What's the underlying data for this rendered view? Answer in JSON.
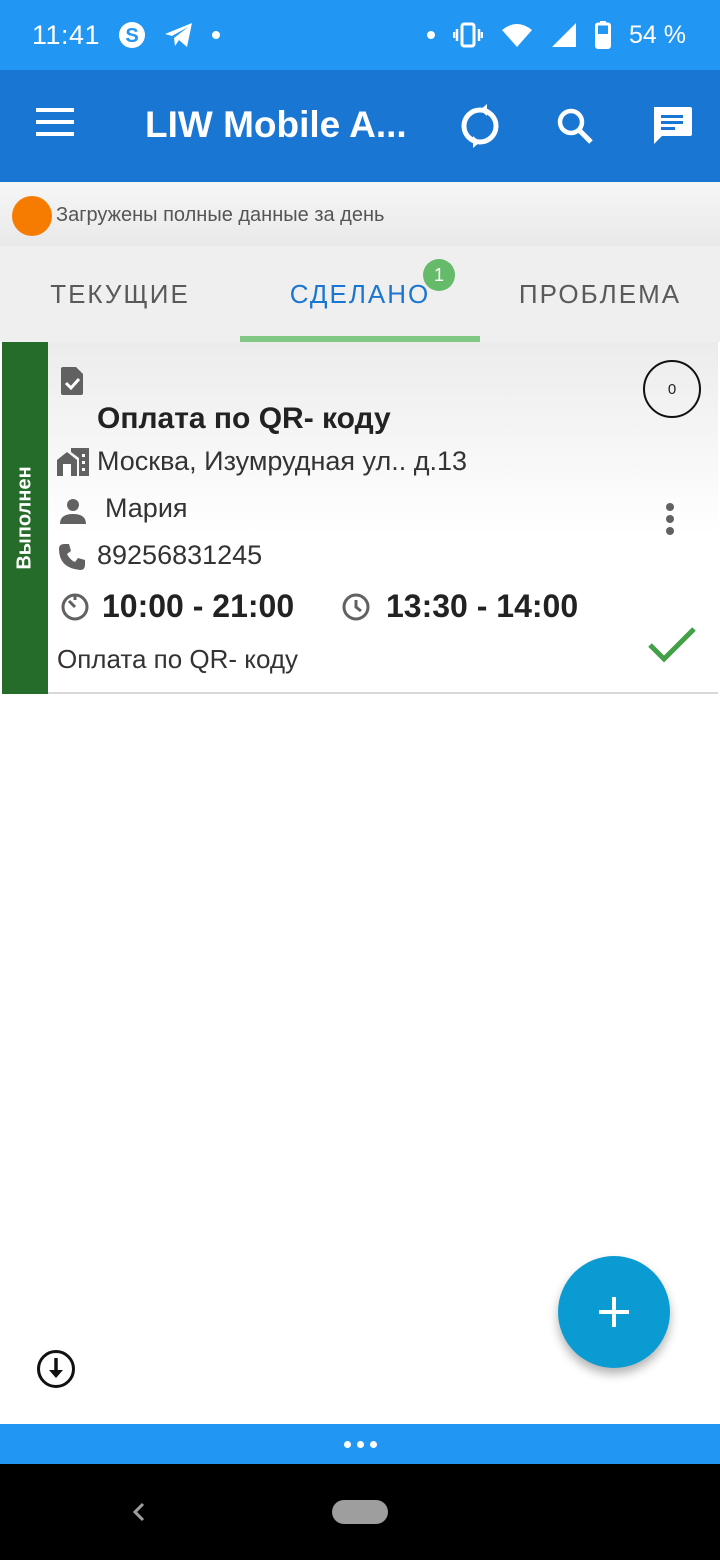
{
  "status_bar": {
    "time": "11:41",
    "battery": "54 %",
    "icons_left": [
      "skype-icon",
      "telegram-icon",
      "notification-dot"
    ],
    "icons_right": [
      "notification-dot",
      "vibrate-icon",
      "wifi-icon",
      "signal-icon",
      "battery-icon"
    ]
  },
  "app_bar": {
    "title": "LIW Mobile A...",
    "actions": [
      "sync-icon",
      "search-icon",
      "chat-icon"
    ],
    "color": "#1976d2"
  },
  "sync_info": {
    "text": "Загружены полные данные за день",
    "dot_color": "#f57c00"
  },
  "tabs": {
    "items": [
      {
        "label": "ТЕКУЩИЕ"
      },
      {
        "label": "СДЕЛАНО",
        "badge": "1",
        "active": true
      },
      {
        "label": "ПРОБЛЕМА"
      }
    ],
    "indicator_color": "#81c784"
  },
  "order": {
    "status": "Выполнен",
    "status_color": "#256b2a",
    "title": "Оплата по QR- коду",
    "address": "Москва, Изумрудная ул.. д.13",
    "contact": "Мария",
    "phone": "89256831245",
    "work_hours": "10:00 - 21:00",
    "delivery_window": "13:30 - 14:00",
    "note": "Оплата по QR- коду",
    "counter": "0",
    "done_check_color": "#43a047"
  },
  "fab": {
    "icon": "plus-icon",
    "color": "#0b9bd3"
  },
  "bottom": {
    "more_icon": "more-horizontal-icon"
  }
}
